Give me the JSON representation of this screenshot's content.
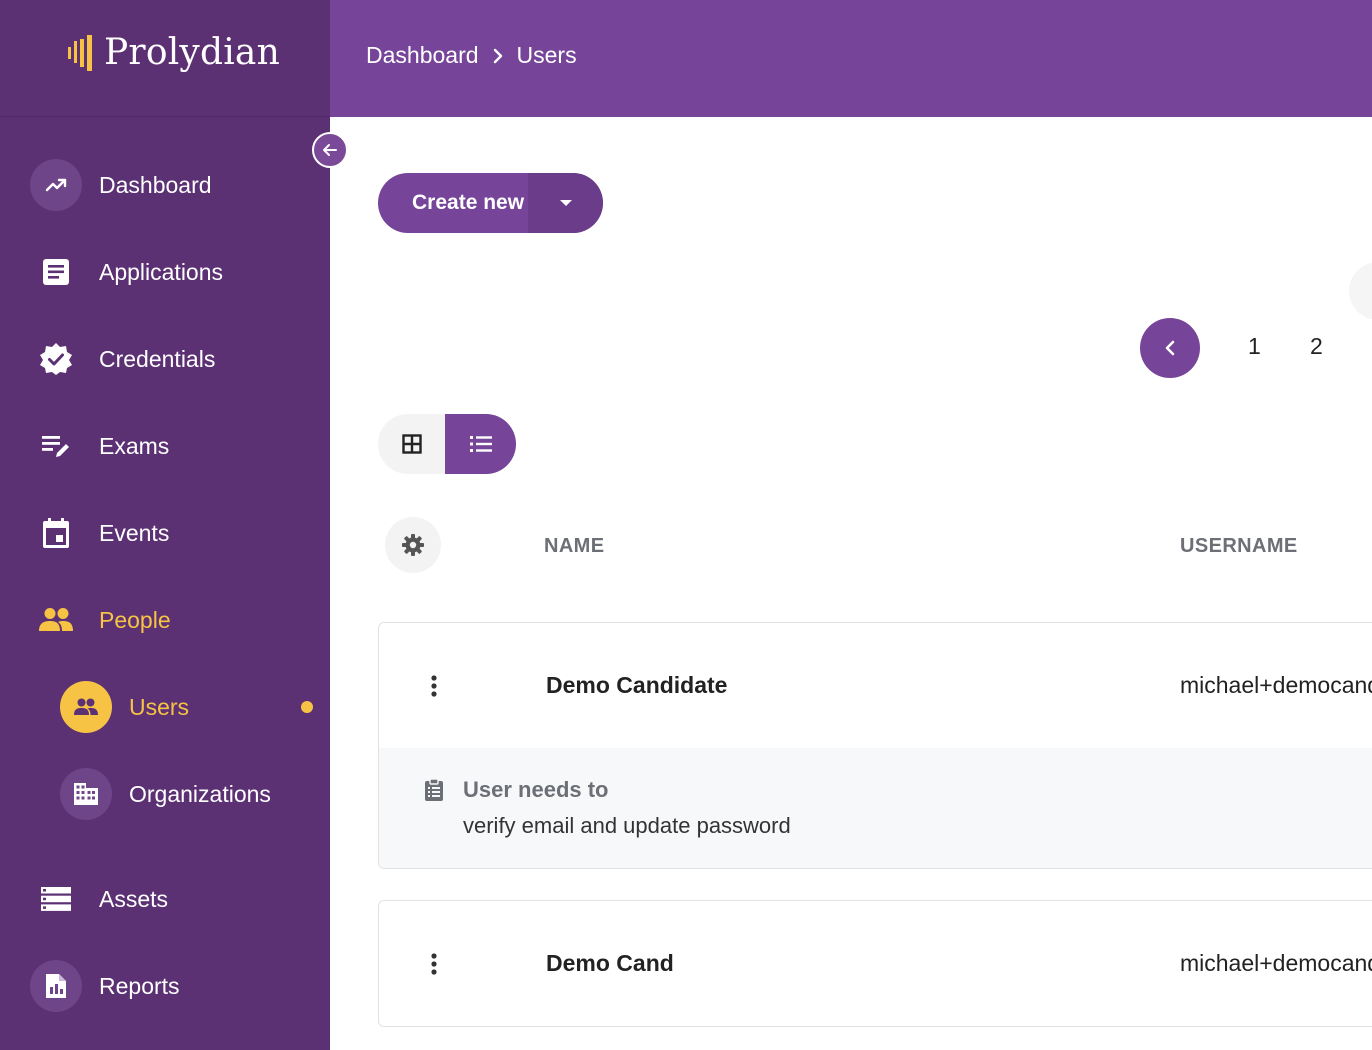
{
  "brand": {
    "name": "Prolydian",
    "accent": "#764599",
    "sidebar_bg": "#5c3174",
    "highlight": "#f6c344"
  },
  "breadcrumb": {
    "items": [
      "Dashboard",
      "Users"
    ]
  },
  "sidebar": {
    "items": [
      {
        "label": "Dashboard",
        "icon": "trending-up-icon"
      },
      {
        "label": "Applications",
        "icon": "document-icon"
      },
      {
        "label": "Credentials",
        "icon": "verified-badge-icon"
      },
      {
        "label": "Exams",
        "icon": "edit-list-icon"
      },
      {
        "label": "Events",
        "icon": "calendar-icon"
      },
      {
        "label": "People",
        "icon": "people-icon"
      },
      {
        "label": "Assets",
        "icon": "server-icon"
      },
      {
        "label": "Reports",
        "icon": "report-icon"
      }
    ],
    "sub_items": [
      {
        "label": "Users",
        "icon": "users-icon"
      },
      {
        "label": "Organizations",
        "icon": "building-icon"
      }
    ]
  },
  "toolbar": {
    "create_label": "Create new"
  },
  "pagination": {
    "pages": [
      "1",
      "2"
    ]
  },
  "table": {
    "columns": [
      "NAME",
      "USERNAME"
    ],
    "rows": [
      {
        "name": "Demo Candidate",
        "username": "michael+democandidate",
        "note_title": "User needs to",
        "note_text": "verify email and update password"
      },
      {
        "name": "Demo Cand",
        "username": "michael+democand"
      }
    ]
  }
}
